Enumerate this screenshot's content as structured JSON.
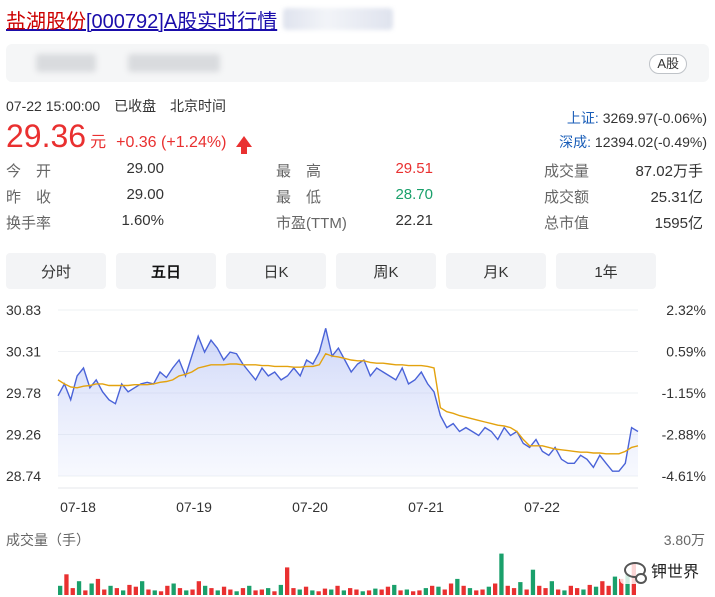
{
  "header": {
    "stock_name": "盐湖股份",
    "stock_code": "[000792]",
    "title_suffix": "A股实时行情",
    "market_badge": "A股"
  },
  "status": {
    "datetime": "07-22 15:00:00",
    "state": "已收盘",
    "timezone": "北京时间"
  },
  "price": {
    "last": "29.36",
    "unit": "元",
    "change": "+0.36 (+1.24%)",
    "direction": "up"
  },
  "indices": [
    {
      "name": "上证:",
      "value": "3269.97(-0.06%)"
    },
    {
      "name": "深成:",
      "value": "12394.02(-0.49%)"
    }
  ],
  "quote": {
    "rows": [
      [
        {
          "label": "今　开",
          "value": "29.00",
          "tone": ""
        },
        {
          "label": "最　高",
          "value": "29.51",
          "tone": "red"
        },
        {
          "label": "成交量",
          "value": "87.02万手",
          "tone": ""
        }
      ],
      [
        {
          "label": "昨　收",
          "value": "29.00",
          "tone": ""
        },
        {
          "label": "最　低",
          "value": "28.70",
          "tone": "green"
        },
        {
          "label": "成交额",
          "value": "25.31亿",
          "tone": ""
        }
      ],
      [
        {
          "label": "换手率",
          "value": "1.60%",
          "tone": ""
        },
        {
          "label": "市盈(TTM)",
          "value": "22.21",
          "tone": ""
        },
        {
          "label": "总市值",
          "value": "1595亿",
          "tone": ""
        }
      ]
    ]
  },
  "tabs": [
    {
      "label": "分时",
      "active": false
    },
    {
      "label": "五日",
      "active": true
    },
    {
      "label": "日K",
      "active": false
    },
    {
      "label": "周K",
      "active": false
    },
    {
      "label": "月K",
      "active": false
    },
    {
      "label": "1年",
      "active": false
    }
  ],
  "chart_data": {
    "type": "line",
    "y_ticks_left": [
      "30.83",
      "30.31",
      "29.78",
      "29.26",
      "28.74"
    ],
    "y_ticks_right": [
      "2.32%",
      "0.59%",
      "-1.15%",
      "-2.88%",
      "-4.61%"
    ],
    "x_ticks": [
      "07-18",
      "07-19",
      "07-20",
      "07-21",
      "07-22"
    ],
    "ylim": [
      28.74,
      30.83
    ],
    "series": [
      {
        "color": "#4a63d8",
        "values": [
          29.75,
          29.9,
          29.7,
          30.0,
          30.1,
          29.85,
          29.95,
          29.8,
          29.7,
          29.65,
          29.9,
          29.8,
          29.85,
          29.9,
          29.92,
          29.9,
          30.05,
          29.98,
          30.1,
          30.2,
          30.0,
          30.25,
          30.5,
          30.3,
          30.45,
          30.35,
          30.2,
          30.3,
          30.28,
          30.15,
          30.05,
          29.95,
          30.1,
          30.0,
          30.05,
          29.95,
          30.0,
          30.1,
          30.0,
          30.2,
          30.15,
          30.3,
          30.6,
          30.25,
          30.35,
          30.2,
          30.05,
          30.15,
          30.2,
          30.0,
          30.1,
          30.05,
          30.0,
          29.95,
          30.1,
          29.9,
          29.95,
          30.05,
          29.9,
          29.8,
          29.5,
          29.35,
          29.4,
          29.3,
          29.35,
          29.3,
          29.25,
          29.35,
          29.3,
          29.2,
          29.35,
          29.25,
          29.3,
          29.15,
          29.1,
          29.2,
          29.05,
          29.0,
          29.1,
          28.95,
          28.9,
          28.9,
          29.0,
          28.95,
          28.85,
          29.0,
          28.9,
          28.8,
          28.8,
          28.9,
          29.35,
          29.3
        ]
      },
      {
        "color": "#e3a20e",
        "values": [
          29.95,
          29.9,
          29.86,
          29.85,
          29.87,
          29.88,
          29.9,
          29.9,
          29.88,
          29.88,
          29.88,
          29.88,
          29.89,
          29.89,
          29.89,
          29.9,
          29.92,
          29.93,
          29.95,
          30.0,
          30.02,
          30.05,
          30.1,
          30.12,
          30.14,
          30.14,
          30.14,
          30.15,
          30.15,
          30.14,
          30.14,
          30.14,
          30.13,
          30.13,
          30.12,
          30.12,
          30.12,
          30.11,
          30.11,
          30.12,
          30.12,
          30.14,
          30.28,
          30.25,
          30.24,
          30.22,
          30.2,
          30.19,
          30.19,
          30.17,
          30.16,
          30.16,
          30.15,
          30.14,
          30.14,
          30.13,
          30.13,
          30.13,
          30.12,
          30.1,
          29.6,
          29.55,
          29.53,
          29.5,
          29.48,
          29.46,
          29.44,
          29.42,
          29.4,
          29.38,
          29.37,
          29.35,
          29.3,
          29.2,
          29.12,
          29.12,
          29.12,
          29.1,
          29.08,
          29.07,
          29.06,
          29.05,
          29.04,
          29.04,
          29.03,
          29.03,
          29.02,
          29.02,
          29.02,
          29.05,
          29.1,
          29.12
        ]
      }
    ],
    "volume": {
      "max_label": "3.80万",
      "bars": [
        0.2,
        0.45,
        0.15,
        0.3,
        0.1,
        0.25,
        0.35,
        0.12,
        0.2,
        0.15,
        0.1,
        0.22,
        0.18,
        0.3,
        0.12,
        0.1,
        0.08,
        0.2,
        0.25,
        0.15,
        0.1,
        0.12,
        0.3,
        0.2,
        0.15,
        0.1,
        0.18,
        0.12,
        0.08,
        0.15,
        0.2,
        0.1,
        0.12,
        0.15,
        0.08,
        0.22,
        0.6,
        0.15,
        0.12,
        0.18,
        0.1,
        0.08,
        0.14,
        0.12,
        0.2,
        0.1,
        0.15,
        0.12,
        0.08,
        0.1,
        0.14,
        0.12,
        0.18,
        0.22,
        0.1,
        0.12,
        0.08,
        0.1,
        0.15,
        0.2,
        0.18,
        0.12,
        0.25,
        0.35,
        0.2,
        0.15,
        0.1,
        0.12,
        0.18,
        0.25,
        0.9,
        0.2,
        0.15,
        0.28,
        0.12,
        0.55,
        0.2,
        0.15,
        0.3,
        0.12,
        0.1,
        0.2,
        0.15,
        0.12,
        0.22,
        0.18,
        0.3,
        0.2,
        0.4,
        0.35,
        0.45,
        0.7
      ]
    }
  },
  "watermark": {
    "text": "钾世界",
    "icon": "wechat-icon"
  }
}
